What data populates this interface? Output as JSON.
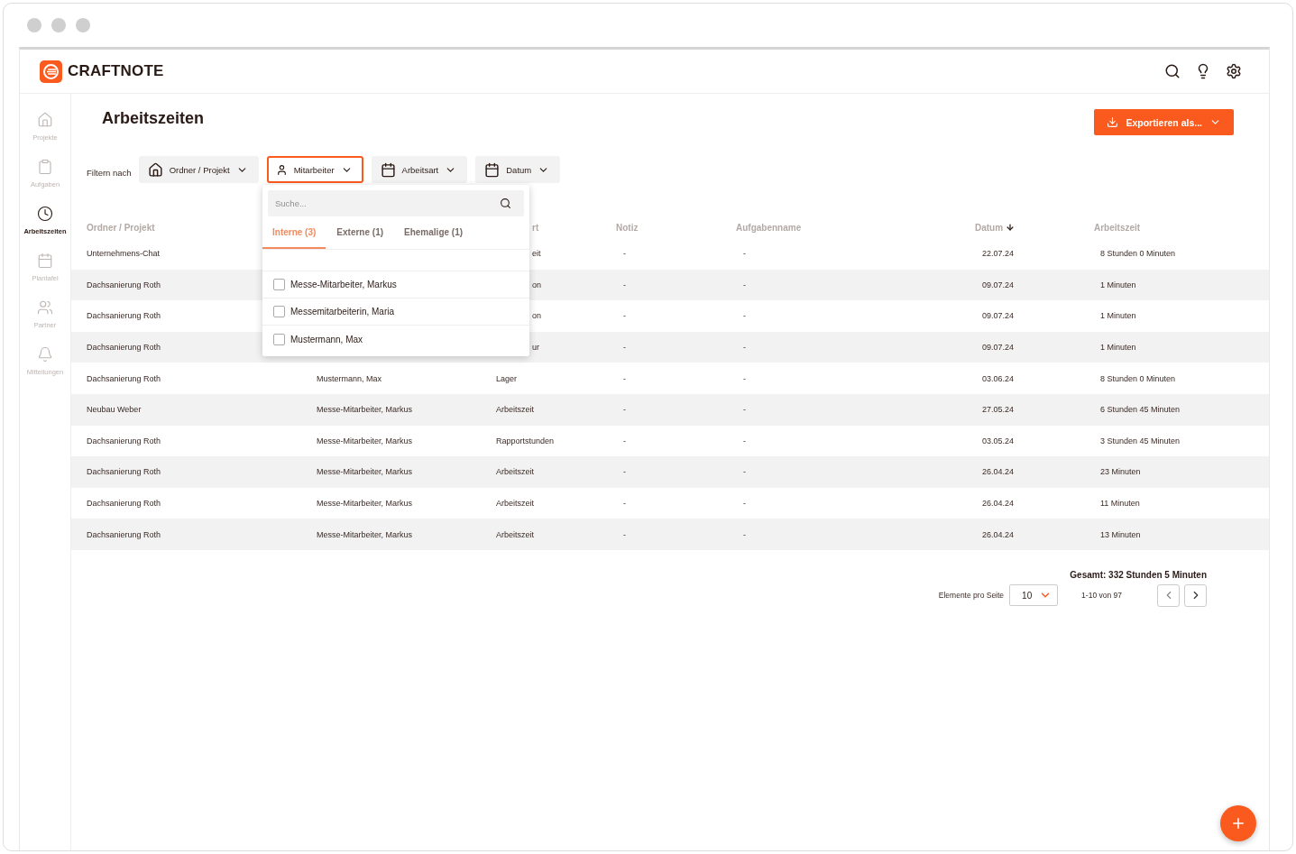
{
  "app": {
    "logo": "CRAFTNOTE"
  },
  "sidebar": {
    "items": [
      {
        "kind": "home",
        "label": "Projekte",
        "selected": false
      },
      {
        "kind": "clipboard",
        "label": "Aufgaben",
        "selected": false
      },
      {
        "kind": "clock",
        "label": "Arbeitszeiten",
        "selected": true
      },
      {
        "kind": "calendar",
        "label": "Plantafel",
        "selected": false
      },
      {
        "kind": "people",
        "label": "Partner",
        "selected": false
      },
      {
        "kind": "bell",
        "label": "Mitteilungen",
        "selected": false
      }
    ]
  },
  "page": {
    "title": "Arbeitszeiten",
    "export_button": "Exportieren als..."
  },
  "filters": {
    "label": "Filtern nach",
    "buttons": [
      {
        "kind": "home",
        "label": "Ordner / Projekt",
        "selected": false
      },
      {
        "kind": "person",
        "label": "Mitarbeiter",
        "selected": true
      },
      {
        "kind": "calendar",
        "label": "Arbeitsart",
        "selected": false
      },
      {
        "kind": "calendar",
        "label": "Datum",
        "selected": false
      }
    ]
  },
  "dropdown": {
    "placeholder": "Suche...",
    "tabs": [
      {
        "label": "Interne (3)",
        "selected": true
      },
      {
        "label": "Externe (1)",
        "selected": false
      },
      {
        "label": "Ehemalige (1)",
        "selected": false
      }
    ],
    "options": [
      {
        "label": "Messe-Mitarbeiter, Markus",
        "checked": false
      },
      {
        "label": "Messemitarbeiterin, Maria",
        "checked": false
      },
      {
        "label": "Mustermann, Max",
        "checked": false
      }
    ]
  },
  "table": {
    "header": {
      "covered": true,
      "cells": [
        {
          "label": "Ordner / Projekt",
          "sorted": false
        },
        null,
        {
          "label": "rt",
          "sorted": false
        },
        {
          "label": "Notiz",
          "sorted": false
        },
        {
          "label": "Aufgabenname",
          "sorted": false
        },
        {
          "label": "Datum",
          "sorted": true
        },
        {
          "label": "Arbeitszeit",
          "sorted": false
        }
      ]
    },
    "rows": [
      {
        "covered": true,
        "cells": [
          "Unternehmens-Chat",
          null,
          "eit",
          "-",
          "-",
          "22.07.24",
          "8 Stunden 0 Minuten"
        ]
      },
      {
        "covered": true,
        "cells": [
          "Dachsanierung Roth",
          null,
          "on",
          "-",
          "-",
          "09.07.24",
          "1 Minuten"
        ]
      },
      {
        "covered": true,
        "cells": [
          "Dachsanierung Roth",
          null,
          "on",
          "-",
          "-",
          "09.07.24",
          "1 Minuten"
        ]
      },
      {
        "covered": true,
        "cells": [
          "Dachsanierung Roth",
          null,
          "ur",
          "-",
          "-",
          "09.07.24",
          "1 Minuten"
        ]
      },
      {
        "covered": false,
        "cells": [
          "Dachsanierung Roth",
          "Mustermann, Max",
          "Lager",
          "-",
          "-",
          "03.06.24",
          "8 Stunden 0 Minuten"
        ]
      },
      {
        "covered": false,
        "cells": [
          "Neubau Weber",
          "Messe-Mitarbeiter, Markus",
          "Arbeitszeit",
          "-",
          "-",
          "27.05.24",
          "6 Stunden 45 Minuten"
        ]
      },
      {
        "covered": false,
        "cells": [
          "Dachsanierung Roth",
          "Messe-Mitarbeiter, Markus",
          "Rapportstunden",
          "-",
          "-",
          "03.05.24",
          "3 Stunden 45 Minuten"
        ]
      },
      {
        "covered": false,
        "cells": [
          "Dachsanierung Roth",
          "Messe-Mitarbeiter, Markus",
          "Arbeitszeit",
          "-",
          "-",
          "26.04.24",
          "23 Minuten"
        ]
      },
      {
        "covered": false,
        "cells": [
          "Dachsanierung Roth",
          "Messe-Mitarbeiter, Markus",
          "Arbeitszeit",
          "-",
          "-",
          "26.04.24",
          "11 Minuten"
        ]
      },
      {
        "covered": false,
        "cells": [
          "Dachsanierung Roth",
          "Messe-Mitarbeiter, Markus",
          "Arbeitszeit",
          "-",
          "-",
          "26.04.24",
          "13 Minuten"
        ]
      }
    ]
  },
  "footer": {
    "total": "Gesamt: 332 Stunden 5 Minuten",
    "per_page_label": "Elemente pro Seite",
    "per_page": "10",
    "range": "1-10 von 97"
  }
}
